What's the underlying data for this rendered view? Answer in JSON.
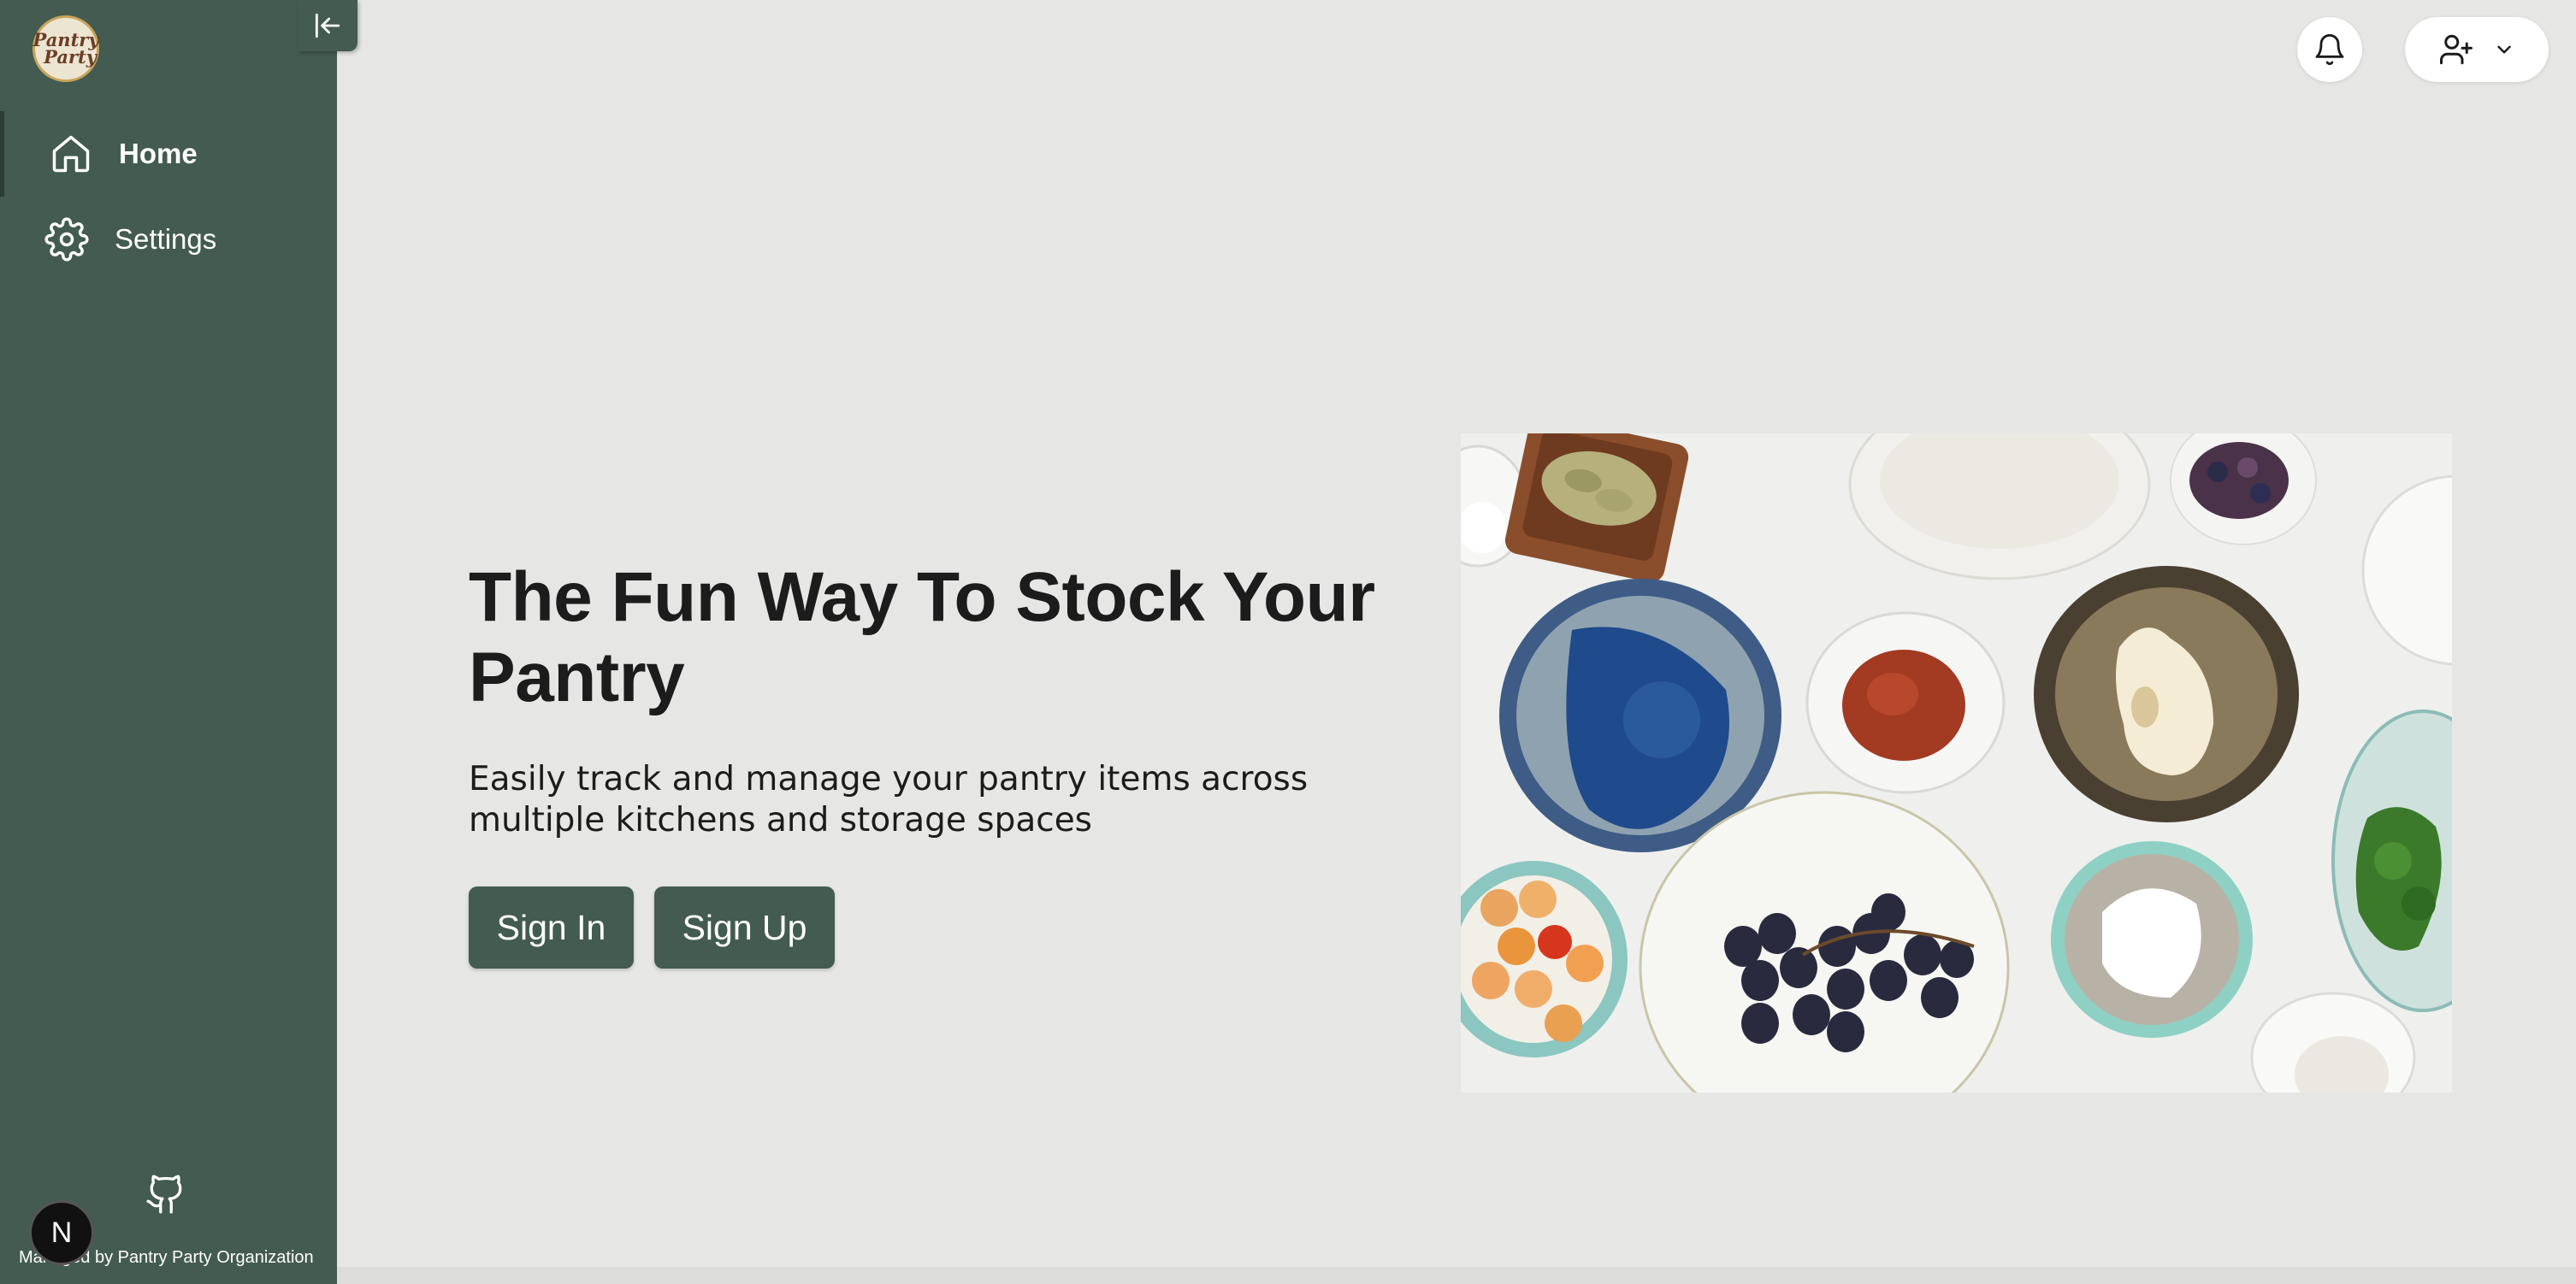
{
  "sidebar": {
    "logo": {
      "line1": "Pantry",
      "line2": "Party"
    },
    "items": [
      {
        "label": "Home",
        "icon": "home-icon",
        "active": true
      },
      {
        "label": "Settings",
        "icon": "gear-icon",
        "active": false
      }
    ],
    "footer": {
      "text": "Managed by Pantry Party Organization",
      "badge": "N"
    }
  },
  "header": {
    "notifications_icon": "bell-icon",
    "user_icon": "user-plus-icon"
  },
  "hero": {
    "title": "The Fun Way To Stock Your Pantry",
    "subtitle": "Easily track and manage your pantry items across multiple kitchens and storage spaces",
    "signin_label": "Sign In",
    "signup_label": "Sign Up"
  },
  "colors": {
    "sidebar": "#435b50",
    "background": "#e6e6e4",
    "button": "#435b50"
  }
}
